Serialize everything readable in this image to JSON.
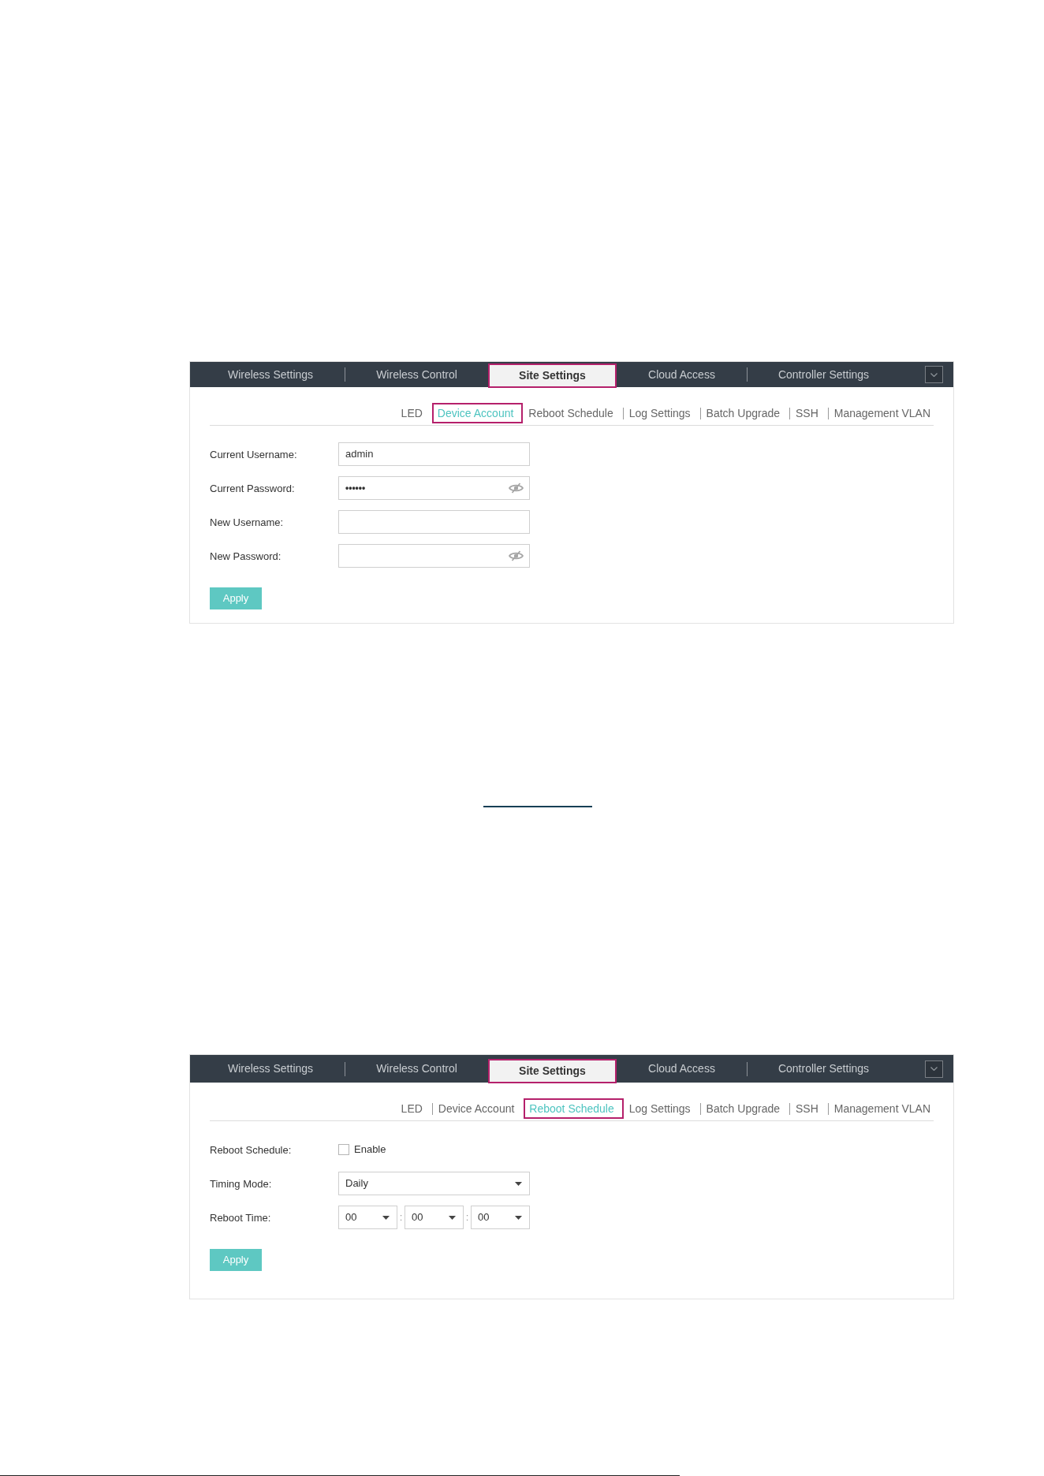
{
  "panels": [
    {
      "nav_tabs": [
        {
          "label": "Wireless Settings",
          "selected": false,
          "highlighted": false
        },
        {
          "label": "Wireless Control",
          "selected": false,
          "highlighted": false
        },
        {
          "label": "Site Settings",
          "selected": true,
          "highlighted": true
        },
        {
          "label": "Cloud Access",
          "selected": false,
          "highlighted": false
        },
        {
          "label": "Controller Settings",
          "selected": false,
          "highlighted": false
        }
      ],
      "sub_tabs": [
        {
          "label": "LED",
          "selected": false,
          "highlighted": false
        },
        {
          "label": "Device Account",
          "selected": true,
          "highlighted": true
        },
        {
          "label": "Reboot Schedule",
          "selected": false,
          "highlighted": false
        },
        {
          "label": "Log Settings",
          "selected": false,
          "highlighted": false
        },
        {
          "label": "Batch Upgrade",
          "selected": false,
          "highlighted": false
        },
        {
          "label": "SSH",
          "selected": false,
          "highlighted": false
        },
        {
          "label": "Management VLAN",
          "selected": false,
          "highlighted": false
        }
      ],
      "fields": [
        {
          "kind": "text",
          "label": "Current Username:",
          "value": "admin"
        },
        {
          "kind": "password",
          "label": "Current Password:",
          "value": "••••••"
        },
        {
          "kind": "text",
          "label": "New Username:"
        },
        {
          "kind": "password",
          "label": "New Password:"
        }
      ],
      "apply_button": "Apply"
    },
    {
      "nav_tabs": [
        {
          "label": "Wireless Settings",
          "selected": false,
          "highlighted": false
        },
        {
          "label": "Wireless Control",
          "selected": false,
          "highlighted": false
        },
        {
          "label": "Site Settings",
          "selected": true,
          "highlighted": true
        },
        {
          "label": "Cloud Access",
          "selected": false,
          "highlighted": false
        },
        {
          "label": "Controller Settings",
          "selected": false,
          "highlighted": false
        }
      ],
      "sub_tabs": [
        {
          "label": "LED",
          "selected": false,
          "highlighted": false
        },
        {
          "label": "Device Account",
          "selected": false,
          "highlighted": false
        },
        {
          "label": "Reboot Schedule",
          "selected": true,
          "highlighted": true
        },
        {
          "label": "Log Settings",
          "selected": false,
          "highlighted": false
        },
        {
          "label": "Batch Upgrade",
          "selected": false,
          "highlighted": false
        },
        {
          "label": "SSH",
          "selected": false,
          "highlighted": false
        },
        {
          "label": "Management VLAN",
          "selected": false,
          "highlighted": false
        }
      ],
      "fields": [
        {
          "kind": "checkbox",
          "label": "Reboot Schedule:",
          "option": "Enable",
          "checked": false
        },
        {
          "kind": "select",
          "label": "Timing Mode:",
          "value": "Daily"
        },
        {
          "kind": "time",
          "label": "Reboot Time:",
          "parts": [
            "00",
            "00",
            "00"
          ],
          "separators": [
            ":",
            ":"
          ]
        }
      ],
      "apply_button": "Apply"
    }
  ]
}
